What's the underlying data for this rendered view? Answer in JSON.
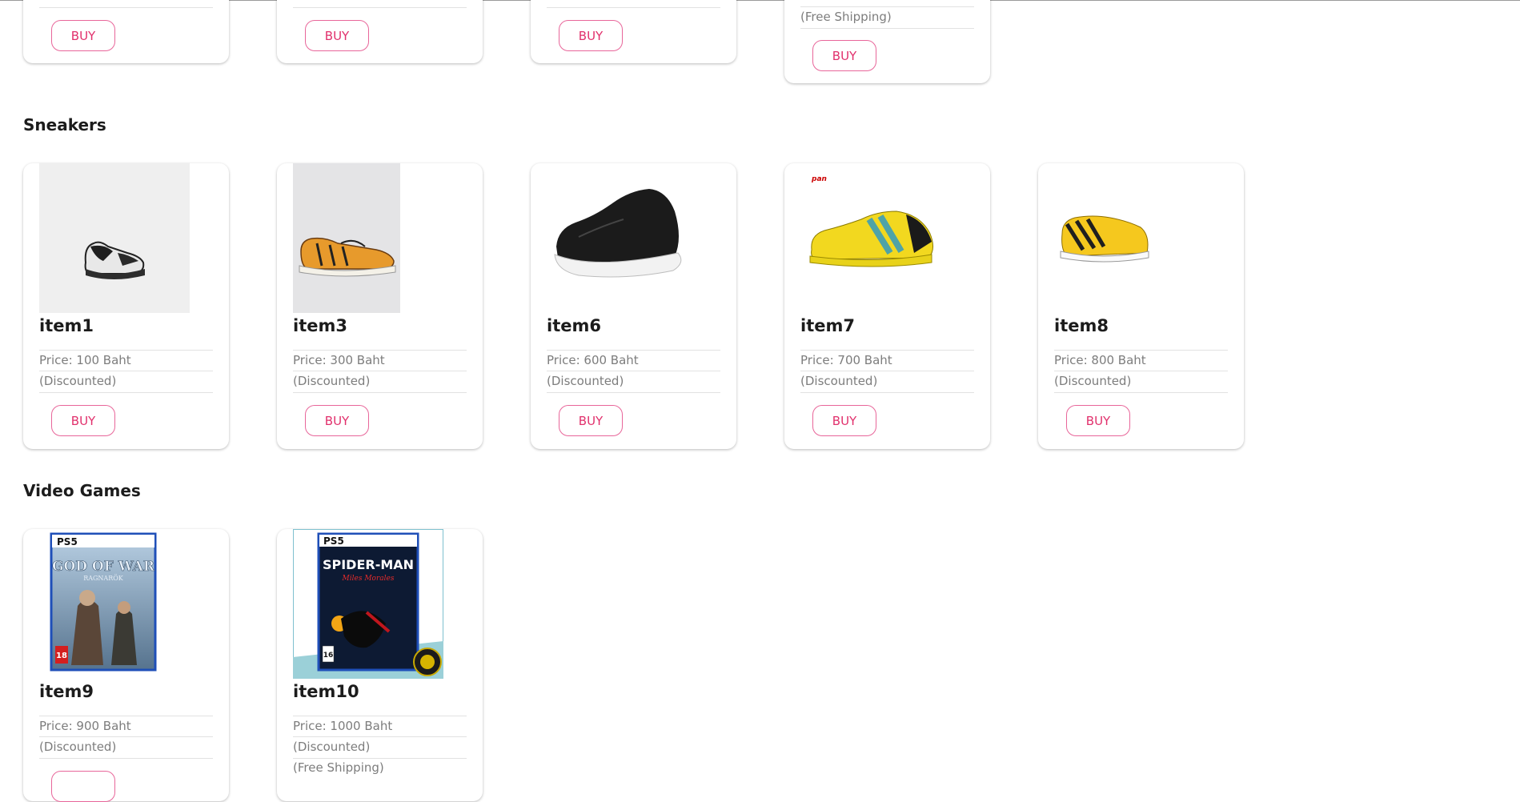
{
  "top_row": {
    "buy_label": "BUY",
    "card4_free_shipping": "(Free Shipping)"
  },
  "sneakers": {
    "title": "Sneakers",
    "items": [
      {
        "name": "item1",
        "price": "Price: 100 Baht",
        "discount": "(Discounted)",
        "buy_label": "BUY"
      },
      {
        "name": "item3",
        "price": "Price: 300 Baht",
        "discount": "(Discounted)",
        "buy_label": "BUY"
      },
      {
        "name": "item6",
        "price": "Price: 600 Baht",
        "discount": "(Discounted)",
        "buy_label": "BUY"
      },
      {
        "name": "item7",
        "price": "Price: 700 Baht",
        "discount": "(Discounted)",
        "buy_label": "BUY",
        "logo_text": "pan"
      },
      {
        "name": "item8",
        "price": "Price: 800 Baht",
        "discount": "(Discounted)",
        "buy_label": "BUY"
      }
    ]
  },
  "video_games": {
    "title": "Video Games",
    "items": [
      {
        "name": "item9",
        "price": "Price: 900 Baht",
        "discount": "(Discounted)",
        "cover_brand": "PS5",
        "cover_title": "GOD OF WAR",
        "cover_subtitle": "RAGNARÖK",
        "cover_rating": "18"
      },
      {
        "name": "item10",
        "price": "Price: 1000 Baht",
        "discount": "(Discounted)",
        "shipping": "(Free Shipping)",
        "cover_brand": "PS5",
        "cover_title": "SPIDER-MAN",
        "cover_subtitle": "Miles Morales",
        "cover_rating": "16"
      }
    ]
  },
  "colors": {
    "accent": "#e1306c",
    "button_border": "#e8669a",
    "muted_text": "#7d7d7d"
  }
}
